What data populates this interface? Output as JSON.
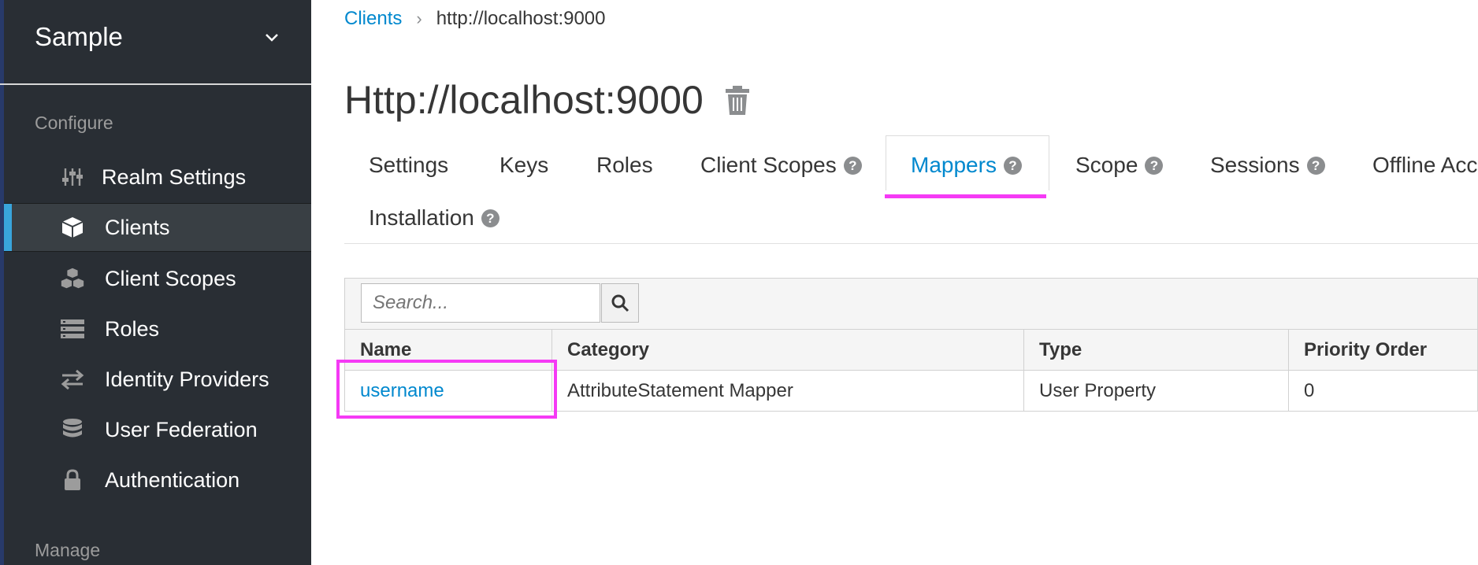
{
  "sidebar": {
    "realm_name": "Sample",
    "configure_label": "Configure",
    "manage_label": "Manage",
    "items": [
      {
        "label": "Realm Settings",
        "icon": "sliders-icon"
      },
      {
        "label": "Clients",
        "icon": "cube-icon",
        "active": true
      },
      {
        "label": "Client Scopes",
        "icon": "cubes-icon"
      },
      {
        "label": "Roles",
        "icon": "list-icon"
      },
      {
        "label": "Identity Providers",
        "icon": "exchange-icon"
      },
      {
        "label": "User Federation",
        "icon": "database-icon"
      },
      {
        "label": "Authentication",
        "icon": "lock-icon"
      }
    ]
  },
  "breadcrumb": {
    "parent": "Clients",
    "current": "http://localhost:9000"
  },
  "page": {
    "title": "Http://localhost:9000"
  },
  "tabs": [
    {
      "label": "Settings"
    },
    {
      "label": "Keys"
    },
    {
      "label": "Roles"
    },
    {
      "label": "Client Scopes",
      "help": true
    },
    {
      "label": "Mappers",
      "help": true,
      "active": true
    },
    {
      "label": "Scope",
      "help": true
    },
    {
      "label": "Sessions",
      "help": true
    },
    {
      "label": "Offline Acc"
    },
    {
      "label": "Installation",
      "help": true
    }
  ],
  "search": {
    "placeholder": "Search..."
  },
  "table": {
    "columns": [
      "Name",
      "Category",
      "Type",
      "Priority Order"
    ],
    "rows": [
      {
        "name": "username",
        "category": "AttributeStatement Mapper",
        "type": "User Property",
        "priority": "0"
      }
    ]
  },
  "colors": {
    "sidebar_bg": "#292e34",
    "accent": "#0088ce",
    "highlight": "#f53af5"
  }
}
